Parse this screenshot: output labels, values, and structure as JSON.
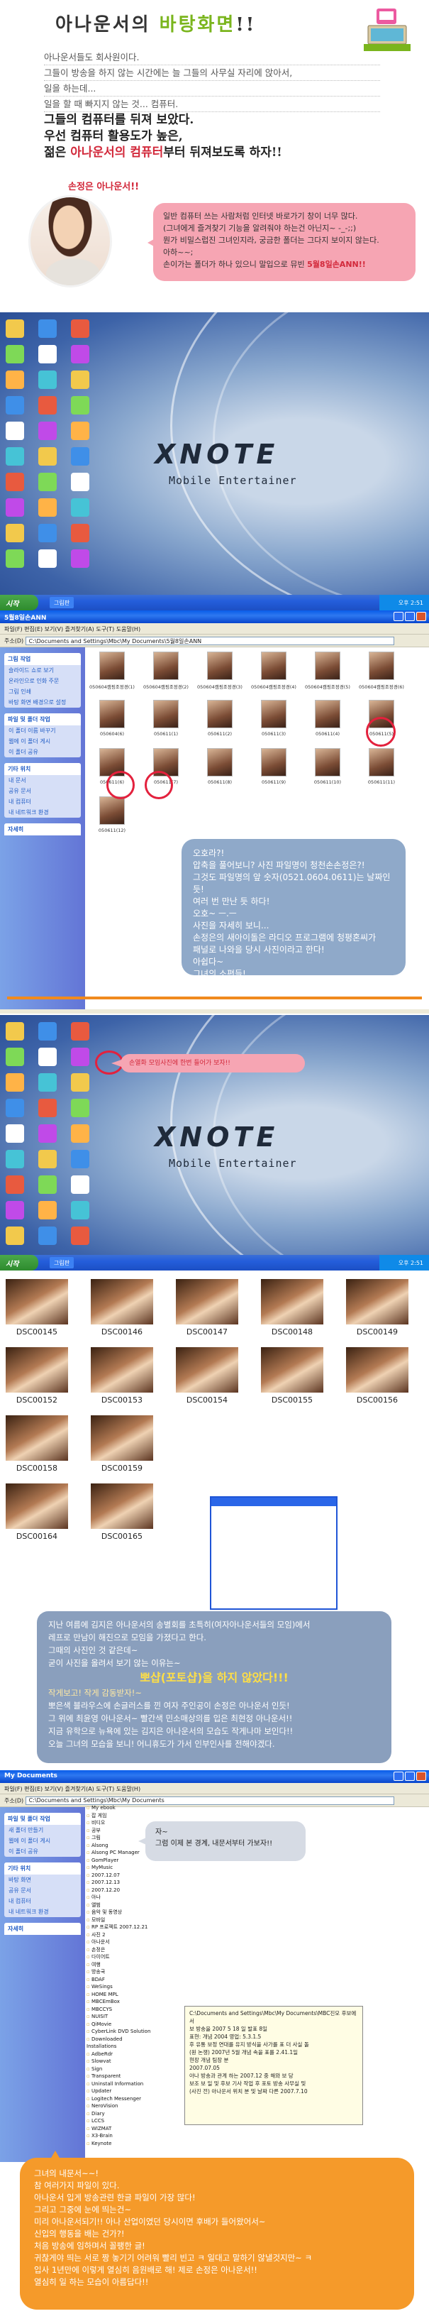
{
  "header": {
    "title_pre": "아나운서의 ",
    "title_accent": "바탕화면",
    "title_post": "!!"
  },
  "intro": {
    "lines": [
      "아나운서들도 회사원이다.",
      "그들이 방송을 하지 않는 시간에는 늘 그들의 사무실 자리에 앉아서,",
      "일을 하는데...",
      "일을 할 때 빠지지 않는 것... 컴퓨터."
    ]
  },
  "lead": {
    "line1": "그들의 컴퓨터를 뒤져 보았다.",
    "line2": "우선 컴퓨터 활용도가 높은,",
    "line3_pre": "젊은 ",
    "line3_hl": "아나운서의 컴퓨터",
    "line3_post": "부터 뒤져보도록 하자!!"
  },
  "signature": "손정은 아나운서!!",
  "bubble1": {
    "l1": "일반 컴퓨터 쓰는 사람처럼 인터넷 바로가기 창이 너무 많다.",
    "l2": "(그녀에게 즐겨찾기 기능을 알려줘야 하는건 아닌지~ -_-;;)",
    "l3": "뭔가 비밀스럽진 그녀인지라, 궁금한 폴더는 그다지 보이지 않는다.",
    "l4": "아하~~;",
    "l5_pre": "손이가는 폴더가 하나 있으니 말입으로 뮤빈 ",
    "l5_hl": "5월8일손ANN!!"
  },
  "desktop1": {
    "brand": "XNOTE",
    "subtitle": "Mobile Entertainer",
    "start": "시작",
    "task": "그림판",
    "clock": "오후 2:51"
  },
  "explorer1": {
    "title": "5월8일손ANN",
    "menu": "파일(F)  편집(E)  보기(V)  즐겨찾기(A)  도구(T)  도움말(H)",
    "address_label": "주소(D)",
    "address": "C:\\Documents and Settings\\Mbc\\My Documents\\5월8일손ANN",
    "panels": [
      {
        "head": "그림 작업",
        "items": [
          "슬라이드 쇼로 보기",
          "온라인으로 인화 주문",
          "그림 인쇄",
          "바탕 화면 배경으로 설정"
        ]
      },
      {
        "head": "파일 및 폴더 작업",
        "items": [
          "이 폴더 이름 바꾸기",
          "웹에 이 폴더 게시",
          "이 폴더 공유"
        ]
      },
      {
        "head": "기타 위치",
        "items": [
          "내 문서",
          "공유 문서",
          "내 컴퓨터",
          "내 네트워크 환경"
        ]
      },
      {
        "head": "자세히",
        "items": []
      }
    ],
    "captions": [
      "050604캠핑조정경(1)",
      "050604캠핑조정경(2)",
      "050604캠핑조정경(3)",
      "050604캠핑조정경(4)",
      "050604캠핑조정경(5)",
      "050604캠핑조정경(6)",
      "050604(6)",
      "050611(1)",
      "050611(2)",
      "050611(3)",
      "050611(4)",
      "050611(5)",
      "050611(6)",
      "050611(7)",
      "050611(8)",
      "050611(9)",
      "050611(10)",
      "050611(11)",
      "050611(12)"
    ]
  },
  "bubble2": {
    "l1": "오호라?!",
    "l2": "압축을 풀어보니? 사진 파일명이 청천손손정은?!",
    "l3": "그것도 파일명의 앞 숫자(0521.0604.0611)는 날짜인듯!",
    "l4": "여러 번 만난 듯 하다!",
    "l5": "오호~ ㅡ.ㅡ",
    "l6": "사진을 자세히 보니...",
    "l7": "손정은의 새아이돌은 라디오 프로그램에 청평혼씨가",
    "l8": "패널로 나와을 당시 사진이라고 한다!",
    "l9": "아쉽다~",
    "l10": "그녀의 소편들!",
    "l11": "참을 수 있었는데~ ㅡ.ㅡ"
  },
  "bubble3": "손열화 모임사진에 한번 들어가 보자!!",
  "desktop2": {
    "brand": "XNOTE",
    "subtitle": "Mobile Entertainer",
    "start": "시작",
    "task": "그림판",
    "clock": "오후 2:51"
  },
  "photos": [
    "DSC00145",
    "DSC00146",
    "DSC00147",
    "DSC00148",
    "DSC00149",
    "DSC00152",
    "DSC00153",
    "DSC00154",
    "DSC00155",
    "DSC00156",
    "DSC00158",
    "DSC00159",
    "",
    "",
    "",
    "DSC00164",
    "DSC00165"
  ],
  "bubble4": {
    "l1": "지난 여름에 김지은 아나운서의 송별회를 초특히(여자아나운서들의 모임)에서",
    "l2": "레프로 만남이 해진으로 모임을 가졌다고 한다.",
    "l3": "그때의 사진인 것 같은데~",
    "l4": "굳이 사진을 올려서 보기 않는 이유는~",
    "big": "뽀샵(포토샵)을 하지 않았다!!!",
    "l5": "작게보고! 작게 감동받자!~",
    "l6": "뽀은색 블라우스에 손글러스를 낀 여자 주인공이 손정은 아나운서 인듯!",
    "l7": "그 위에 최윤영 아나운서~ 빨간색 민소매상의를 입은 최현정 아나운서!!",
    "l8": "지금 유학으로 뉴욕에 있는 김지은 아나운서의 모습도 작게나마 보인다!!",
    "l9": "오늘 그녀의 모습을 보니! 어니휴도가 가서 인부인사를 전해야겠다."
  },
  "explorer2": {
    "title": "My Documents",
    "menu": "파일(F)  편집(E)  보기(V)  즐겨찾기(A)  도구(T)  도움말(H)",
    "address_label": "주소(D)",
    "address": "C:\\Documents and Settings\\Mbc\\My Documents",
    "panels": [
      {
        "head": "파일 및 폴더 작업",
        "items": [
          "새 폴더 만들기",
          "웹에 이 폴더 게시",
          "이 폴더 공유"
        ]
      },
      {
        "head": "기타 위치",
        "items": [
          "바탕 화면",
          "공유 문서",
          "내 컴퓨터",
          "내 네트워크 환경"
        ]
      },
      {
        "head": "자세히",
        "items": []
      }
    ],
    "tree": [
      "My ebook",
      "잡 게임",
      "비디오",
      "공부",
      "그림",
      "Alsong",
      "Alsong PC Manager",
      "GomPlayer",
      "MyMusic",
      "2007.12.07",
      "2007.12.13",
      "2007.12.20",
      "아나",
      "앨범",
      "음악 및 동영상",
      "모바일",
      "RP 프로젝트 2007.12.21",
      "사진 2",
      "아나운서",
      "손정은",
      "다이어트",
      "여행",
      "방송국",
      "BDAF",
      "WeSings",
      "HOME MPL",
      "MBCEmBox",
      "MBCCYS",
      "NUISIT",
      "QiMovie",
      "CyberLink DVD Solution",
      "Downloaded Installations",
      "AdbeRdr",
      "Slowvat",
      "Sign",
      "Transparent",
      "Uninstall Information",
      "Updater",
      "Logitech Messenger",
      "NeroVision",
      "Diary",
      "LCCS",
      "WIZMAT",
      "X3-Brain",
      "Keynote"
    ],
    "popup_lines": [
      "C:\\Documents and Settings\\Mbc\\My Documents\\MBC진모 후보에 서",
      "보 방송을 2007 5 18 일 발표 8일",
      "표현: 개념 2004 영업: 5.3.1.5",
      "후 유통 보정 연대를 유지 방식을 사가를 표 더 사실 돌",
      "(원 논쟁) 2007년 5월 개념 속을 표를 2.41.1일",
      "현장 개념 팀장 분",
      "2007.07.05",
      "아나 방송과 관계 하는 2007.12 중 해와 보 당",
      "",
      "보조 보 일 및 후보 기사 작업 후 포토 방송 사무실 및",
      "(사진 전) 아나운서 위치 분 및 날짜 다른 2007.7.10"
    ]
  },
  "bubble5": {
    "l1": "자~",
    "l2": "그럼 이제 본 경계, 내문서부터 가보자!!"
  },
  "bubble6": {
    "l1": "그녀의 내문서~~!",
    "l2": "참 여러가지 파일이 있다.",
    "l3": "아나운서 입게 방송관련 한글 파일이 가장 많다!",
    "l4": "그리고 그중에 눈에 띄는건~",
    "l5": "미리 아나운서되기!! 아나 산업이였던 당시이면 후배가 들어왔어서~",
    "l6": "신입의 행동을 배는 건가?!",
    "l7": "처음 방송에 임하며서 꼴팽한 글!",
    "l8": "귀찮게야 띄는 서로 짱 놓기기 어려워 빨리 빈고 ㅋ 일대고 말하기 않낼것지만~ ㅋ",
    "l9": "입사 1년만에 이렇게 열심히 음원배로 해! 제로 손정은 아나운서!!",
    "l10": "열심히 일 하는 모습이 아름답다!!"
  },
  "colors": {
    "accent": "#7ab51d",
    "highlight": "#d2283a",
    "pink_bubble": "#f6a5b3",
    "blue_bubble": "#8fa9c9",
    "orange": "#f08a1e"
  }
}
